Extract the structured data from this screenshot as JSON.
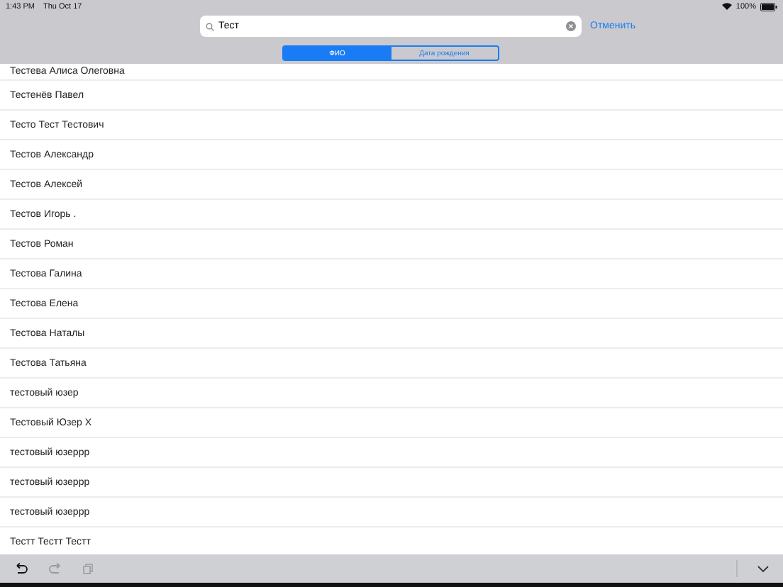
{
  "status_bar": {
    "time": "1:43 PM",
    "date": "Thu Oct 17",
    "battery": "100%"
  },
  "search": {
    "value": "Тест",
    "cancel": "Отменить"
  },
  "scope": [
    {
      "label": "ФИО",
      "selected": true
    },
    {
      "label": "Дата рождения",
      "selected": false
    }
  ],
  "rows": [
    "Тестева Алиса Олеговна",
    "Тестенёв Павел",
    "Тесто Тест Тестович",
    "Тестов Александр",
    "Тестов Алексей",
    "Тестов Игорь .",
    "Тестов Роман",
    "Тестова Галина",
    "Тестова Елена",
    "Тестова Наталы",
    "Тестова Татьяна",
    "тестовый юзер",
    "Тестовый Юзер X",
    "тестовый юзеррр",
    "тестовый юзеррр",
    "тестовый юзеррр",
    "Тестт Тестт Тестт"
  ]
}
